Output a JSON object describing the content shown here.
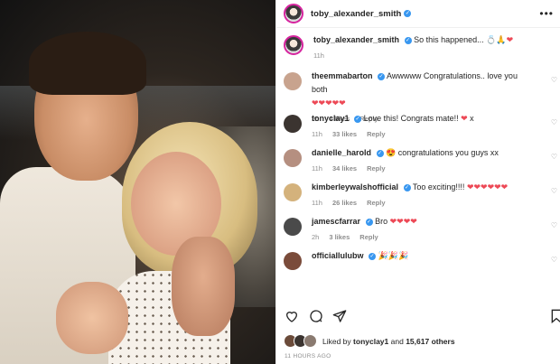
{
  "post": {
    "username": "toby_alexander_smith",
    "more_icon": "more-icon"
  },
  "caption": {
    "username": "toby_alexander_smith",
    "text": "So this happened...",
    "emojis": "💍🙏❤",
    "time": "11h"
  },
  "comments": [
    {
      "username": "theemmabarton",
      "verified": true,
      "text": "Awwwww Congratulations.. love you both",
      "text2": "❤❤❤❤❤",
      "time": "2h",
      "likes": "4 likes",
      "reply": "Reply",
      "avatar_color": "#c8a38e"
    },
    {
      "username": "tonyclay1",
      "verified": true,
      "text": "Love this! Congrats mate!! ❤ x",
      "text2": "",
      "time": "11h",
      "likes": "33 likes",
      "reply": "Reply",
      "avatar_color": "#3b3430"
    },
    {
      "username": "danielle_harold",
      "verified": true,
      "text": "😍 congratulations you guys xx",
      "text2": "",
      "time": "11h",
      "likes": "34 likes",
      "reply": "Reply",
      "avatar_color": "#b58f80"
    },
    {
      "username": "kimberleywalshofficial",
      "verified": true,
      "text": "Too exciting!!!! ❤❤❤❤❤❤",
      "text2": "",
      "time": "11h",
      "likes": "26 likes",
      "reply": "Reply",
      "avatar_color": "#d4b27c"
    },
    {
      "username": "jamescfarrar",
      "verified": true,
      "text": "Bro ❤❤❤❤",
      "text2": "",
      "time": "2h",
      "likes": "3 likes",
      "reply": "Reply",
      "avatar_color": "#4a4a4a"
    },
    {
      "username": "officiallulubw",
      "verified": true,
      "text": "🎉🎉🎉",
      "text2": "",
      "time": "",
      "likes": "",
      "reply": "",
      "avatar_color": "#7a4b3a"
    }
  ],
  "liked_by": {
    "prefix": "Liked by",
    "user": "tonyclay1",
    "middle": "and",
    "count": "15,617 others"
  },
  "timestamp": "11 HOURS AGO",
  "colors": {
    "heart": "#ed4956",
    "verified": "#3897f0",
    "meta": "#8e8e8e"
  }
}
